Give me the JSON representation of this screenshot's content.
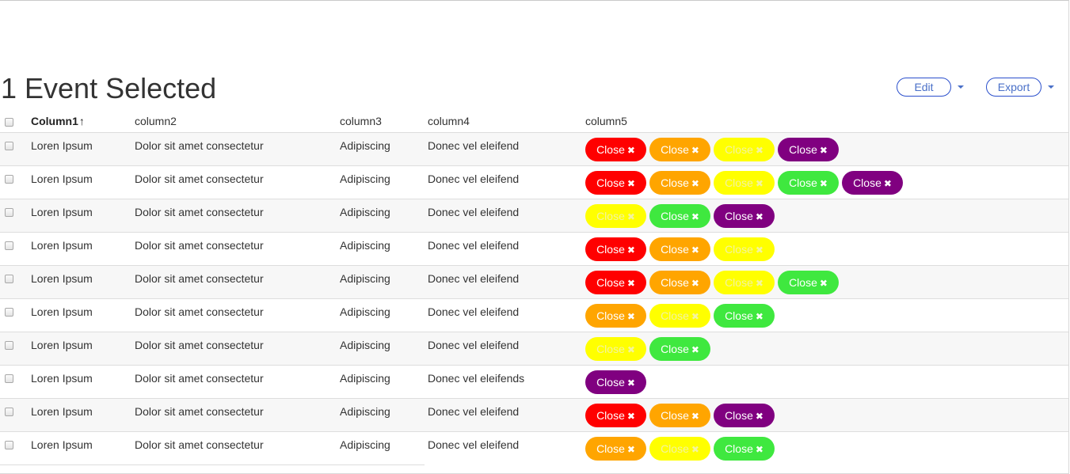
{
  "page": {
    "title": "1 Event Selected"
  },
  "actions": {
    "edit_label": "Edit",
    "export_label": "Export"
  },
  "table": {
    "columns": [
      "Column1",
      "column2",
      "column3",
      "column4",
      "column5"
    ],
    "sort_indicator": "↑",
    "close_label": "Close",
    "close_icon": "✖",
    "rows": [
      {
        "c1": "Loren Ipsum",
        "c2": "Dolor sit amet consectetur",
        "c3": "Adipiscing",
        "c4": "Donec vel eleifend",
        "tags": [
          "red",
          "orange",
          "yellow",
          "purple"
        ]
      },
      {
        "c1": "Loren Ipsum",
        "c2": "Dolor sit amet consectetur",
        "c3": "Adipiscing",
        "c4": "Donec vel eleifend",
        "tags": [
          "red",
          "orange",
          "yellow",
          "green",
          "purple"
        ]
      },
      {
        "c1": "Loren Ipsum",
        "c2": "Dolor sit amet consectetur",
        "c3": "Adipiscing",
        "c4": "Donec vel eleifend",
        "tags": [
          "yellow",
          "green",
          "purple"
        ]
      },
      {
        "c1": "Loren Ipsum",
        "c2": "Dolor sit amet consectetur",
        "c3": "Adipiscing",
        "c4": "Donec vel eleifend",
        "tags": [
          "red",
          "orange",
          "yellow"
        ]
      },
      {
        "c1": "Loren Ipsum",
        "c2": "Dolor sit amet consectetur",
        "c3": "Adipiscing",
        "c4": "Donec vel eleifend",
        "tags": [
          "red",
          "orange",
          "yellow",
          "green"
        ]
      },
      {
        "c1": "Loren Ipsum",
        "c2": "Dolor sit amet consectetur",
        "c3": "Adipiscing",
        "c4": "Donec vel eleifend",
        "tags": [
          "orange",
          "yellow",
          "green"
        ]
      },
      {
        "c1": "Loren Ipsum",
        "c2": "Dolor sit amet consectetur",
        "c3": "Adipiscing",
        "c4": "Donec vel eleifend",
        "tags": [
          "yellow",
          "green"
        ]
      },
      {
        "c1": "Loren Ipsum",
        "c2": "Dolor sit amet consectetur",
        "c3": "Adipiscing",
        "c4": "Donec vel eleifends",
        "tags": [
          "purple"
        ]
      },
      {
        "c1": "Loren Ipsum",
        "c2": "Dolor sit amet consectetur",
        "c3": "Adipiscing",
        "c4": "Donec vel eleifend",
        "tags": [
          "red",
          "orange",
          "purple"
        ]
      },
      {
        "c1": "Loren Ipsum",
        "c2": "Dolor sit amet consectetur",
        "c3": "Adipiscing",
        "c4": "Donec vel eleifend",
        "tags": [
          "orange",
          "yellow",
          "green"
        ]
      }
    ]
  },
  "colors": {
    "red": "#ff0000",
    "orange": "#ffa500",
    "yellow": "#ffff00",
    "green": "#3fe83f",
    "purple": "#800080",
    "button_border": "#2a4fcc",
    "button_text": "#4a70c8",
    "stripe": "#f7f7f7"
  }
}
